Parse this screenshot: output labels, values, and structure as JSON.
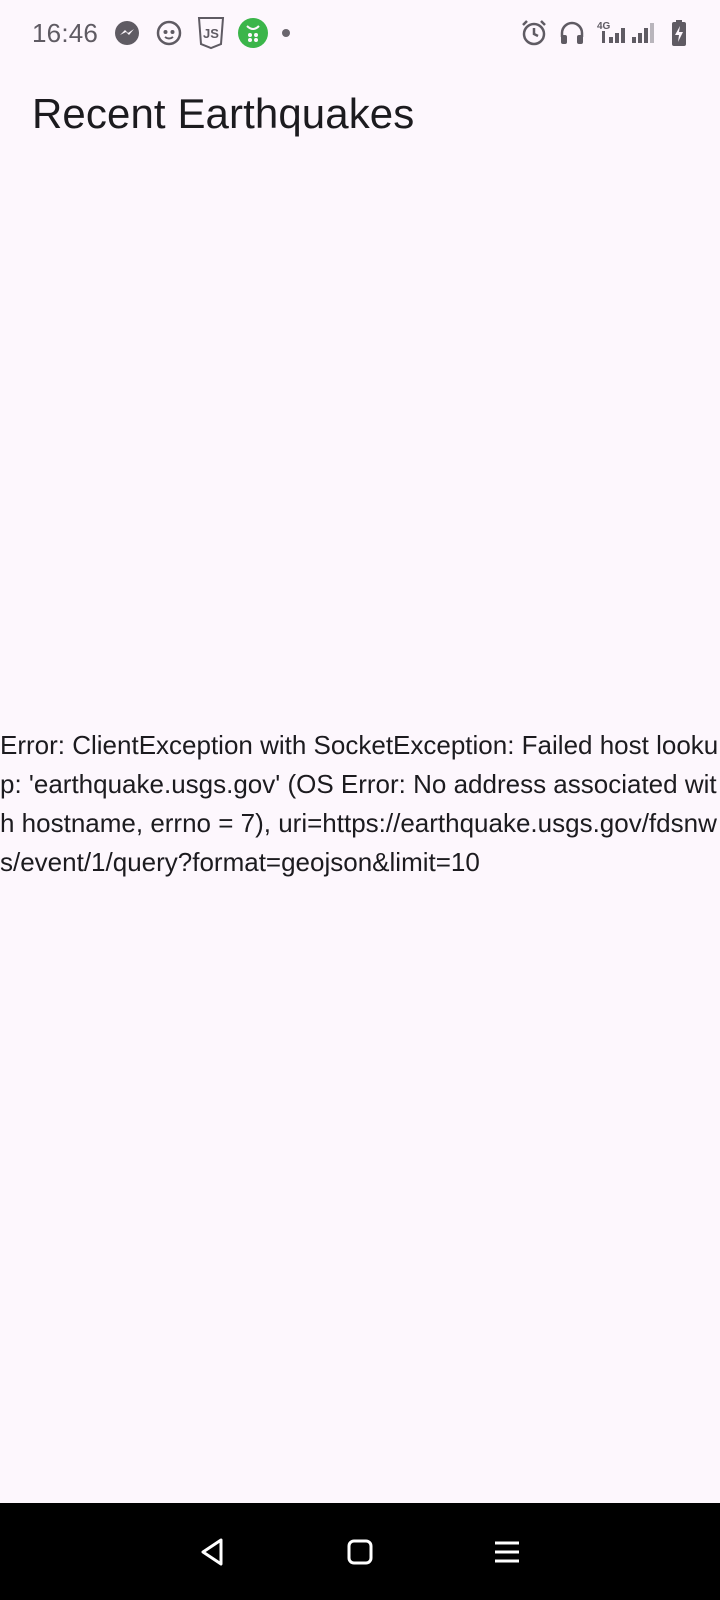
{
  "status_bar": {
    "time": "16:46",
    "left_icons": [
      "messenger-icon",
      "cat-app-icon",
      "javascript-icon",
      "green-app-icon"
    ],
    "right_icons": [
      "alarm-icon",
      "headphones-icon",
      "signal-4g-icon",
      "battery-charging-icon"
    ],
    "network_label": "4G"
  },
  "app": {
    "title": "Recent Earthquakes"
  },
  "content": {
    "error_message": "Error: ClientException with SocketException: Failed host lookup: 'earthquake.usgs.gov' (OS Error: No address associated with hostname, errno = 7), uri=https://earthquake.usgs.gov/fdsnws/event/1/query?format=geojson&limit=10"
  },
  "navigation": {
    "buttons": [
      "back-icon",
      "home-icon",
      "recents-icon"
    ]
  },
  "colors": {
    "background": "#fdf7fd",
    "text": "#1c1b1f",
    "nav_bar": "#000000",
    "green_app": "#3bb54a"
  }
}
